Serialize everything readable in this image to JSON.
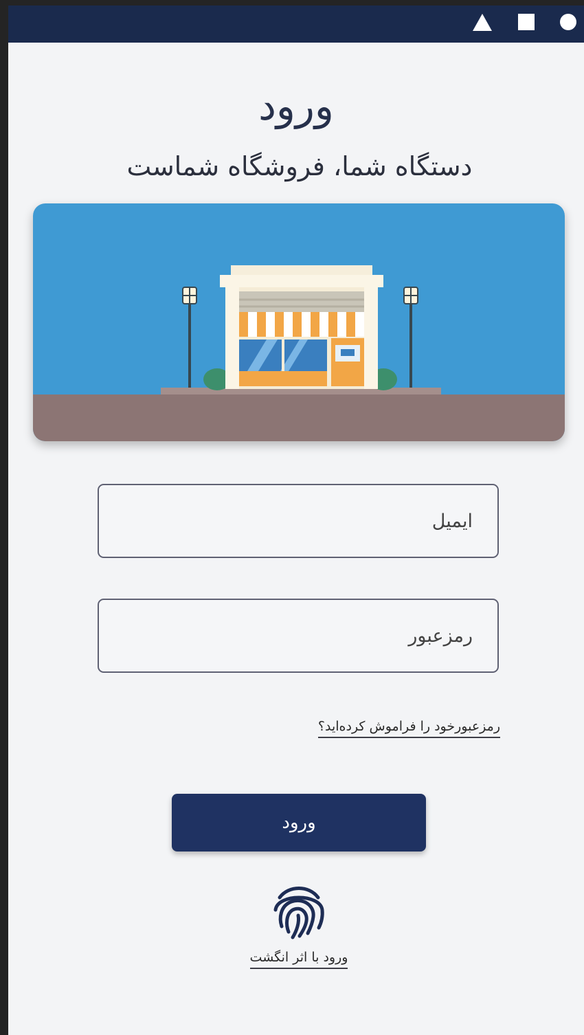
{
  "status_bar": {
    "icons": [
      "triangle-icon",
      "square-icon",
      "circle-icon"
    ]
  },
  "header": {
    "title": "ورود",
    "subtitle": "دستگاه شما، فروشگاه شماست"
  },
  "hero": {
    "image": "storefront-illustration",
    "sky_color": "#3f9ad3",
    "ground_color": "#8c7574"
  },
  "form": {
    "email_placeholder": "ایمیل",
    "password_placeholder": "رمزعبور",
    "forgot_link": "رمزعبورخود را فراموش کرده‌اید؟",
    "login_button": "ورود"
  },
  "fingerprint": {
    "icon": "fingerprint-icon",
    "label": "ورود با اثر انگشت"
  },
  "colors": {
    "primary": "#1f3262",
    "status_bar": "#1a2a4d",
    "background": "#f3f4f6"
  }
}
